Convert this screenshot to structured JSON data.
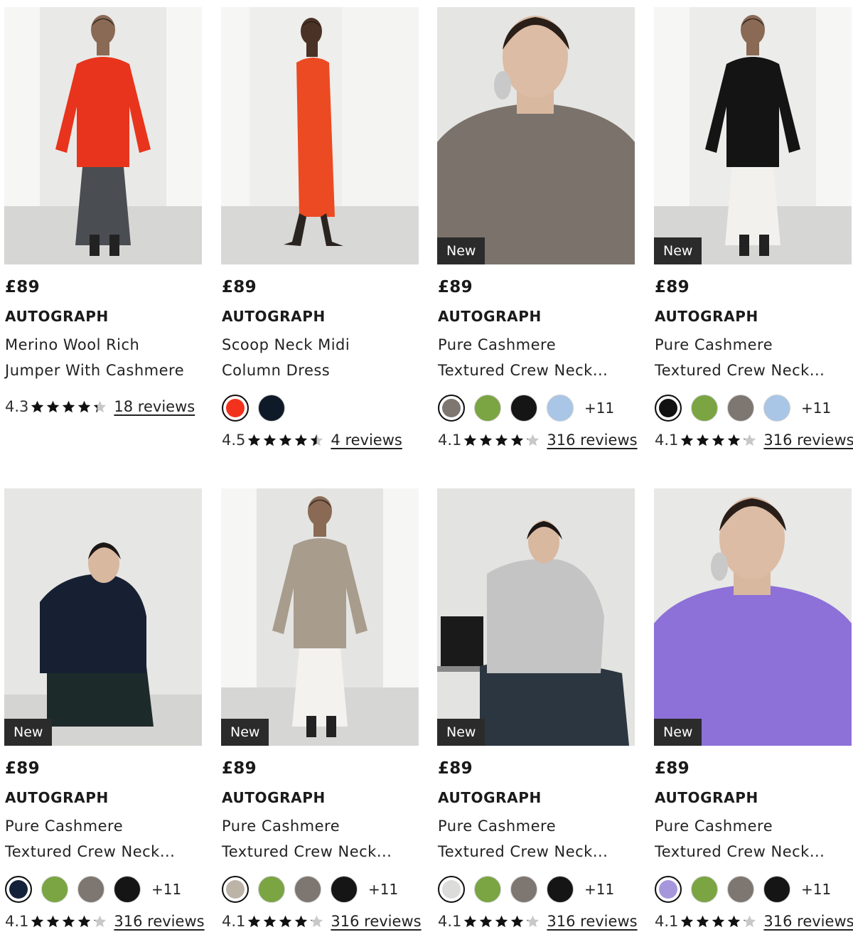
{
  "products": [
    {
      "badge": "",
      "price": "£89",
      "brand": "AUTOGRAPH",
      "name1": "Merino Wool Rich",
      "name2": "Jumper With Cashmere",
      "swatches": [],
      "more": "",
      "rating": "4.3",
      "rating_value": 4.3,
      "reviews": "18 reviews",
      "image": {
        "bg": "#e9e9e7",
        "garment": "#e8341c",
        "lower": "#4a4d52",
        "pose": "walk"
      }
    },
    {
      "badge": "",
      "price": "£89",
      "brand": "AUTOGRAPH",
      "name1": "Scoop Neck Midi",
      "name2": "Column Dress",
      "swatches": [
        {
          "color": "#f2321c",
          "selected": true
        },
        {
          "color": "#0f1a28",
          "selected": false
        }
      ],
      "more": "",
      "rating": "4.5",
      "rating_value": 4.5,
      "reviews": "4 reviews",
      "image": {
        "bg": "#eeeeec",
        "garment": "#ec4a22",
        "lower": "#ec4a22",
        "pose": "side"
      }
    },
    {
      "badge": "New",
      "price": "£89",
      "brand": "AUTOGRAPH",
      "name1": "Pure Cashmere",
      "name2": "Textured Crew Neck...",
      "swatches": [
        {
          "color": "#7e7670",
          "selected": true
        },
        {
          "color": "#7aa542",
          "selected": false
        },
        {
          "color": "#151515",
          "selected": false
        },
        {
          "color": "#a9c6e6",
          "selected": false
        }
      ],
      "more": "+11",
      "rating": "4.1",
      "rating_value": 4.1,
      "reviews": "316 reviews",
      "image": {
        "bg": "#e5e5e3",
        "garment": "#7b726b",
        "lower": "#2a2a2a",
        "pose": "close"
      }
    },
    {
      "badge": "New",
      "price": "£89",
      "brand": "AUTOGRAPH",
      "name1": "Pure Cashmere",
      "name2": "Textured Crew Neck...",
      "swatches": [
        {
          "color": "#111111",
          "selected": true
        },
        {
          "color": "#7aa542",
          "selected": false
        },
        {
          "color": "#7e7670",
          "selected": false
        },
        {
          "color": "#a9c6e6",
          "selected": false
        }
      ],
      "more": "+11",
      "rating": "4.1",
      "rating_value": 4.1,
      "reviews": "316 reviews",
      "image": {
        "bg": "#ececea",
        "garment": "#141414",
        "lower": "#f2f1ee",
        "pose": "walk"
      }
    },
    {
      "badge": "New",
      "price": "£89",
      "brand": "AUTOGRAPH",
      "name1": "Pure Cashmere",
      "name2": "Textured Crew Neck...",
      "swatches": [
        {
          "color": "#14213a",
          "selected": true
        },
        {
          "color": "#7aa542",
          "selected": false
        },
        {
          "color": "#7e7670",
          "selected": false
        },
        {
          "color": "#151515",
          "selected": false
        }
      ],
      "more": "+11",
      "rating": "4.1",
      "rating_value": 4.1,
      "reviews": "316 reviews",
      "image": {
        "bg": "#e6e6e4",
        "garment": "#172033",
        "lower": "#1d2a2a",
        "pose": "crouch"
      }
    },
    {
      "badge": "New",
      "price": "£89",
      "brand": "AUTOGRAPH",
      "name1": "Pure Cashmere",
      "name2": "Textured Crew Neck...",
      "swatches": [
        {
          "color": "#bdb4a8",
          "selected": true
        },
        {
          "color": "#7aa542",
          "selected": false
        },
        {
          "color": "#7e7670",
          "selected": false
        },
        {
          "color": "#151515",
          "selected": false
        }
      ],
      "more": "+11",
      "rating": "4.1",
      "rating_value": 4.1,
      "reviews": "316 reviews",
      "image": {
        "bg": "#e4e4e2",
        "garment": "#a89c8d",
        "lower": "#f3f2ef",
        "pose": "stand"
      }
    },
    {
      "badge": "New",
      "price": "£89",
      "brand": "AUTOGRAPH",
      "name1": "Pure Cashmere",
      "name2": "Textured Crew Neck...",
      "swatches": [
        {
          "color": "#dcdcda",
          "selected": true
        },
        {
          "color": "#7aa542",
          "selected": false
        },
        {
          "color": "#7e7670",
          "selected": false
        },
        {
          "color": "#151515",
          "selected": false
        }
      ],
      "more": "+11",
      "rating": "4.1",
      "rating_value": 4.1,
      "reviews": "316 reviews",
      "image": {
        "bg": "#e3e3e1",
        "garment": "#c4c4c4",
        "lower": "#2c3640",
        "pose": "sit"
      }
    },
    {
      "badge": "New",
      "price": "£89",
      "brand": "AUTOGRAPH",
      "name1": "Pure Cashmere",
      "name2": "Textured Crew Neck...",
      "swatches": [
        {
          "color": "#a697dd",
          "selected": true
        },
        {
          "color": "#7aa542",
          "selected": false
        },
        {
          "color": "#7e7670",
          "selected": false
        },
        {
          "color": "#151515",
          "selected": false
        }
      ],
      "more": "+11",
      "rating": "4.1",
      "rating_value": 4.1,
      "reviews": "316 reviews",
      "image": {
        "bg": "#e8e8e6",
        "garment": "#8d70d8",
        "lower": "#8d70d8",
        "pose": "profile"
      }
    }
  ]
}
